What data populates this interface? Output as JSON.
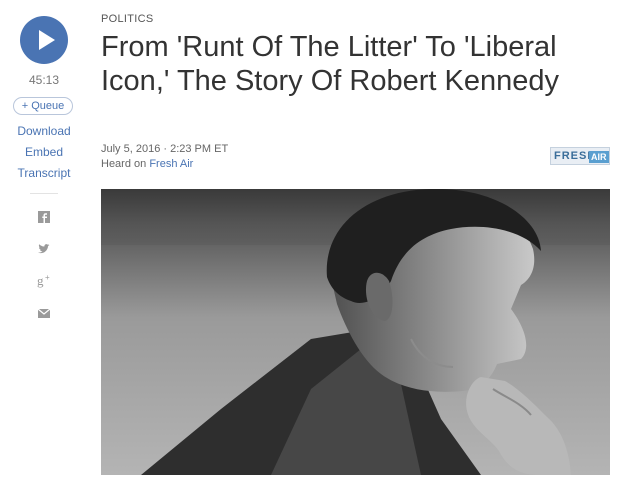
{
  "player": {
    "duration": "45:13",
    "queue_label": "+ Queue",
    "download_label": "Download",
    "embed_label": "Embed",
    "transcript_label": "Transcript"
  },
  "share": {
    "icons": [
      "facebook-icon",
      "twitter-icon",
      "google-plus-icon",
      "email-icon"
    ]
  },
  "article": {
    "slug": "POLITICS",
    "headline": "From 'Runt Of The Litter' To 'Liberal Icon,' The Story Of Robert Kennedy",
    "date": "July 5, 2016 · 2:23 PM ET",
    "heard_on_prefix": "Heard on",
    "show_name": "Fresh Air",
    "show_logo_word1": "FRESH",
    "show_logo_word2": "AIR"
  },
  "colors": {
    "accent": "#4a74b3",
    "text": "#333333",
    "muted": "#777777"
  }
}
